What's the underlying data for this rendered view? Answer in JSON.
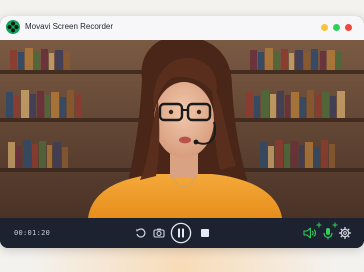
{
  "window": {
    "title": "Movavi Screen Recorder",
    "controls": [
      "minimize",
      "maximize",
      "close"
    ]
  },
  "recorder": {
    "elapsed_time": "00:01:20",
    "buttons": [
      {
        "name": "restart",
        "icon": "restart-icon"
      },
      {
        "name": "screenshot",
        "icon": "camera-icon"
      },
      {
        "name": "pause",
        "icon": "pause-icon"
      },
      {
        "name": "stop",
        "icon": "stop-icon"
      },
      {
        "name": "system-audio",
        "icon": "speaker-icon",
        "state": "on"
      },
      {
        "name": "microphone",
        "icon": "microphone-icon",
        "state": "on"
      },
      {
        "name": "settings",
        "icon": "gear-icon"
      }
    ]
  },
  "colors": {
    "titlebar": "#f7f7f9",
    "toolbar": "#1d2230",
    "active_audio": "#2fd05b",
    "accent_yellow": "#f7c43a",
    "accent_green": "#2fd05b",
    "accent_red": "#f0483e"
  }
}
